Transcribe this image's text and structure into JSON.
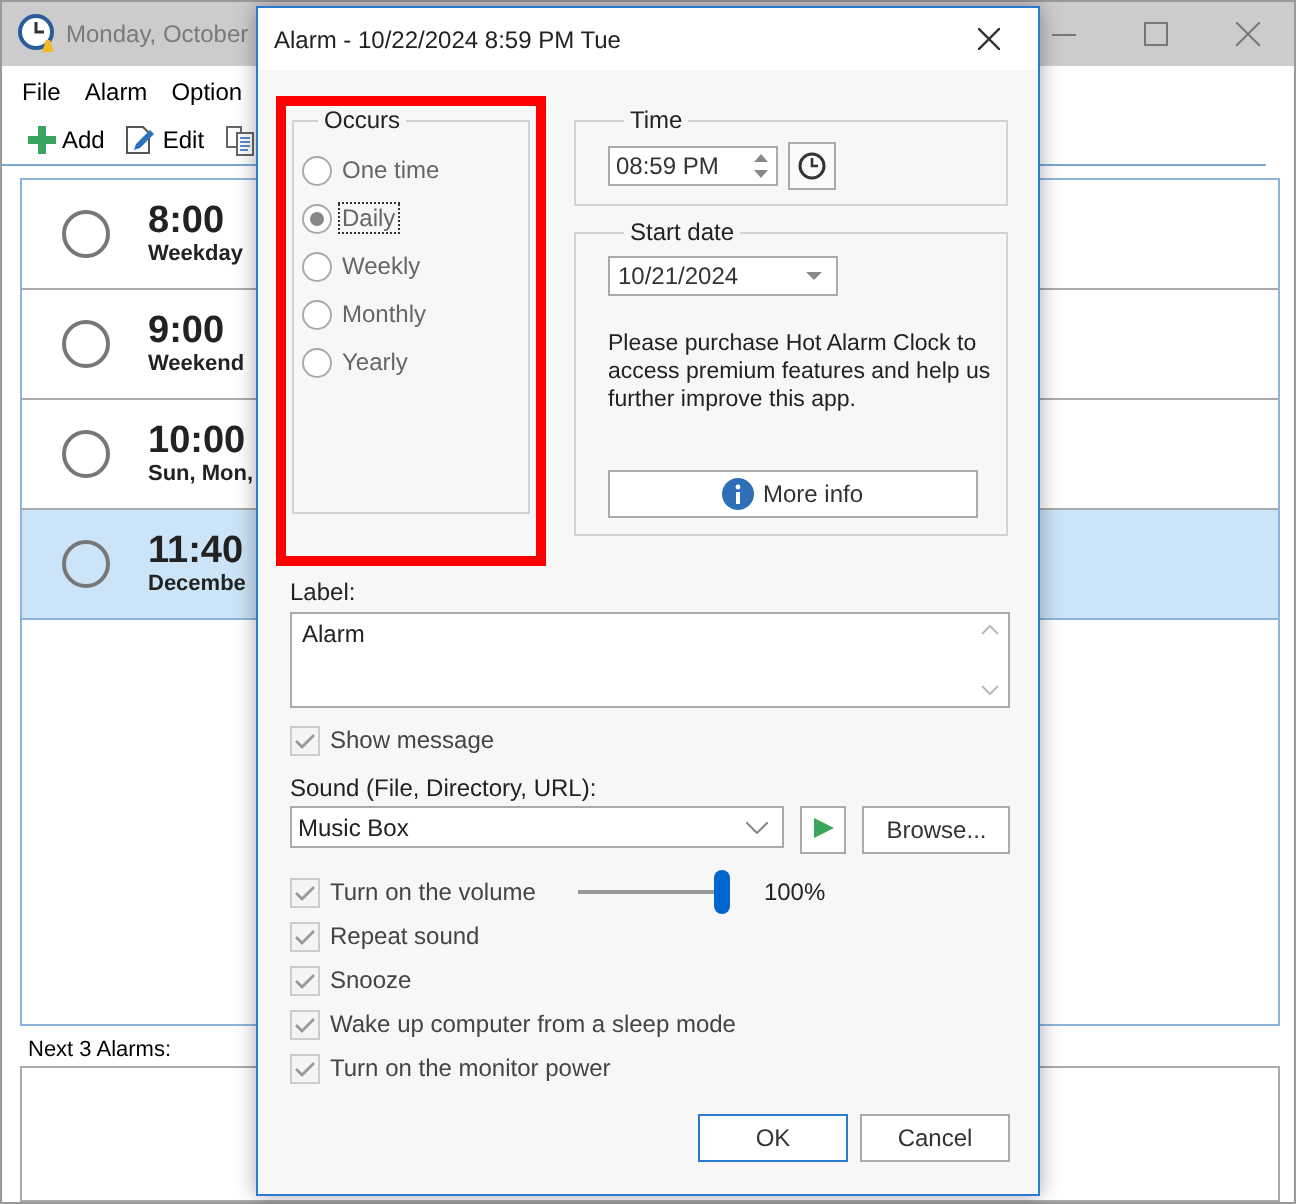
{
  "main_window": {
    "title": "Monday, October",
    "menu": [
      "File",
      "Alarm",
      "Option"
    ],
    "toolbar": [
      {
        "kind": "add",
        "label": "Add"
      },
      {
        "kind": "edit",
        "label": "Edit"
      },
      {
        "kind": "copy"
      }
    ],
    "alarms": [
      {
        "time": "8:00",
        "detail": "Weekday",
        "selected": false
      },
      {
        "time": "9:00",
        "detail": "Weekend",
        "selected": false
      },
      {
        "time": "10:00",
        "detail": "Sun, Mon,",
        "selected": false
      },
      {
        "time": "11:40",
        "detail": "Decembe",
        "selected": true
      }
    ],
    "next_alarms": {
      "label": "Next 3 Alarms:"
    }
  },
  "dialog": {
    "title": "Alarm - 10/22/2024 8:59 PM Tue",
    "occurs": {
      "legend": "Occurs",
      "highlighted": true,
      "options": [
        {
          "label": "One time",
          "selected": false,
          "focused": false
        },
        {
          "label": "Daily",
          "selected": true,
          "focused": true
        },
        {
          "label": "Weekly",
          "selected": false,
          "focused": false
        },
        {
          "label": "Monthly",
          "selected": false,
          "focused": false
        },
        {
          "label": "Yearly",
          "selected": false,
          "focused": false
        }
      ]
    },
    "time": {
      "legend": "Time",
      "value": "08:59 PM"
    },
    "start_date": {
      "legend": "Start date",
      "value": "10/21/2024",
      "note": "Please purchase Hot Alarm Clock to access premium features and help us further improve this app.",
      "more_info": "More info"
    },
    "label": {
      "caption": "Label:",
      "value": "Alarm"
    },
    "show_message": {
      "label": "Show message",
      "checked": true
    },
    "sound": {
      "caption": "Sound (File, Directory, URL):",
      "value": "Music Box",
      "browse": "Browse..."
    },
    "options": [
      {
        "kind": "volume",
        "label": "Turn on the volume",
        "checked": true,
        "level": 1,
        "reading": "100%"
      },
      {
        "kind": "check",
        "label": "Repeat sound",
        "checked": true
      },
      {
        "kind": "check",
        "label": "Snooze",
        "checked": true
      },
      {
        "kind": "check",
        "label": "Wake up computer from a sleep mode",
        "checked": true
      },
      {
        "kind": "check",
        "label": "Turn on the monitor power",
        "checked": true
      }
    ],
    "buttons": [
      {
        "label": "OK",
        "default": true
      },
      {
        "label": "Cancel",
        "default": false
      }
    ]
  }
}
